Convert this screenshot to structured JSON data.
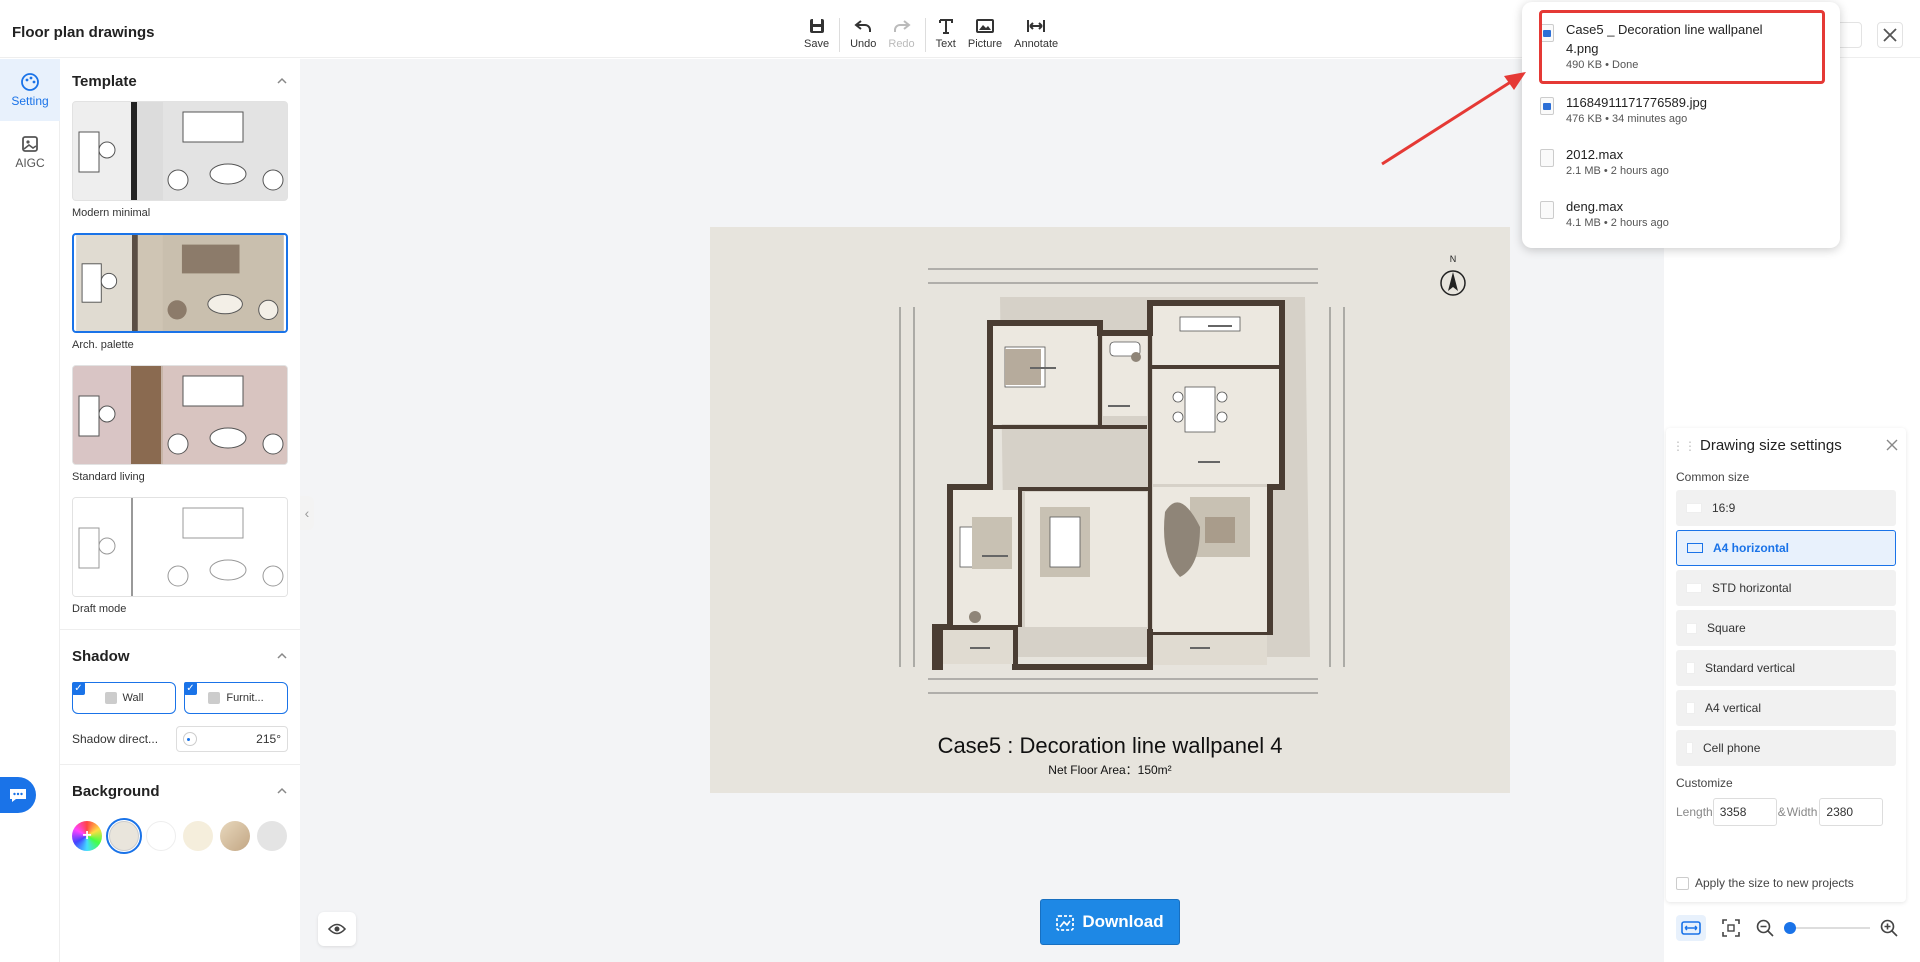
{
  "header": {
    "title": "Floor plan drawings"
  },
  "toolbar": {
    "save": "Save",
    "undo": "Undo",
    "redo": "Redo",
    "text": "Text",
    "picture": "Picture",
    "annotate": "Annotate"
  },
  "rail": {
    "setting": "Setting",
    "aigc": "AIGC"
  },
  "template": {
    "heading": "Template",
    "items": [
      {
        "label": "Modern minimal"
      },
      {
        "label": "Arch. palette",
        "selected": true
      },
      {
        "label": "Standard living"
      },
      {
        "label": "Draft mode"
      }
    ]
  },
  "shadow": {
    "heading": "Shadow",
    "wall": "Wall",
    "furniture": "Furnit...",
    "direction_label": "Shadow direct...",
    "direction_value": "215°"
  },
  "background": {
    "heading": "Background",
    "swatches": [
      "#e9e5dc",
      "#ffffff",
      "#f5eedc",
      "#d6c1a0",
      "#e4e4e4"
    ]
  },
  "drawing": {
    "title": "Case5 : Decoration line wallpanel 4",
    "subtitle": "Net Floor Area：150m²",
    "north": "N"
  },
  "download": {
    "label": "Download"
  },
  "downloads": [
    {
      "name": "Case5 _ Decoration line wallpanel 4.png",
      "meta": "490 KB • Done",
      "type": "image"
    },
    {
      "name": "11684911171776589.jpg",
      "meta": "476 KB • 34 minutes ago",
      "type": "image"
    },
    {
      "name": "2012.max",
      "meta": "2.1 MB • 2 hours ago",
      "type": "file"
    },
    {
      "name": "deng.max",
      "meta": "4.1 MB • 2 hours ago",
      "type": "file"
    }
  ],
  "size_panel": {
    "title": "Drawing size settings",
    "common_label": "Common size",
    "options": [
      "16:9",
      "A4 horizontal",
      "STD horizontal",
      "Square",
      "Standard vertical",
      "A4 vertical",
      "Cell phone"
    ],
    "active_option": "A4 horizontal",
    "customize_label": "Customize",
    "length_label": "Length",
    "length_value": "3358",
    "link_symbol": "&",
    "width_label": "Width",
    "width_value": "2380",
    "apply_label": "Apply the size to new projects"
  },
  "colors": {
    "accent": "#1a73e8",
    "download": "#1e88e5",
    "highlight": "#e53935"
  }
}
